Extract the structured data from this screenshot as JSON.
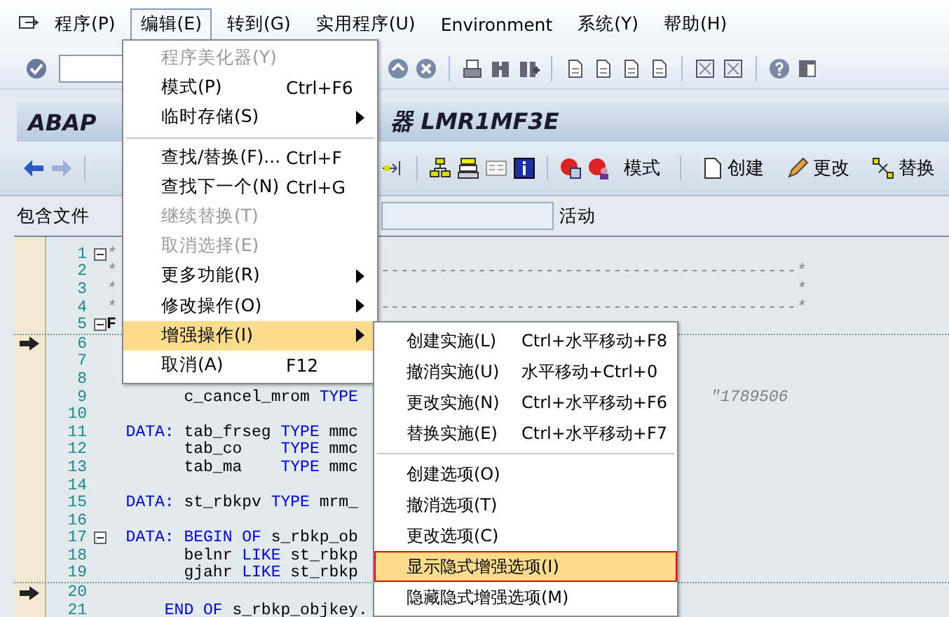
{
  "menubar": {
    "items": [
      {
        "label": "程序(P)",
        "selected": false
      },
      {
        "label": "编辑(E)",
        "selected": true
      },
      {
        "label": "转到(G)",
        "selected": false
      },
      {
        "label": "实用程序(U)",
        "selected": false
      },
      {
        "label": "Environment",
        "selected": false
      },
      {
        "label": "系统(Y)",
        "selected": false
      },
      {
        "label": "帮助(H)",
        "selected": false
      }
    ]
  },
  "title": {
    "visible_start": "ABAP",
    "visible_end": "器 LMR1MF3E"
  },
  "app_toolbar": {
    "buttons": [
      {
        "label": "模式",
        "kind": "text"
      },
      {
        "label": "创建",
        "kind": "new"
      },
      {
        "label": "更改",
        "kind": "edit"
      },
      {
        "label": "替换",
        "kind": "replace"
      }
    ]
  },
  "include_row": {
    "label": "包含文件",
    "status": "活动"
  },
  "editor": {
    "lines": [
      {
        "number": "1",
        "arrow": false,
        "collapsible": true,
        "left": [
          {
            "text": "*",
            "kind": "comment"
          }
        ]
      },
      {
        "number": "2",
        "arrow": false,
        "collapsible": false,
        "left": [
          {
            "text": "*",
            "kind": "comment"
          }
        ],
        "middle": [
          {
            "text": "-------------------------------------------*",
            "kind": "comment"
          }
        ]
      },
      {
        "number": "3",
        "arrow": false,
        "collapsible": false,
        "left": [
          {
            "text": "*",
            "kind": "comment"
          }
        ],
        "middle": [
          {
            "text": "*",
            "kind": "comment"
          }
        ]
      },
      {
        "number": "4",
        "arrow": false,
        "collapsible": false,
        "left": [
          {
            "text": "*",
            "kind": "comment"
          }
        ],
        "middle": [
          {
            "text": "-------------------------------------------*",
            "kind": "comment"
          }
        ]
      },
      {
        "number": "5",
        "arrow": false,
        "collapsible": true,
        "left": [
          {
            "text": "F",
            "kind": "bold"
          }
        ]
      },
      {
        "number": "6",
        "arrow": true,
        "collapsible": false,
        "separator": true
      },
      {
        "number": "7",
        "arrow": false,
        "collapsible": false
      },
      {
        "number": "8",
        "arrow": false,
        "collapsible": false
      },
      {
        "number": "9",
        "arrow": false,
        "collapsible": false,
        "left": [
          {
            "text": "        c_cancel_mrom ",
            "kind": "plain"
          },
          {
            "text": "TYPE",
            "kind": "keyword"
          }
        ],
        "right": [
          {
            "text": "\"1789506",
            "kind": "comment"
          }
        ]
      },
      {
        "number": "10",
        "arrow": false,
        "collapsible": false
      },
      {
        "number": "11",
        "arrow": false,
        "collapsible": false,
        "left": [
          {
            "text": "  DATA:",
            "kind": "keyword"
          },
          {
            "text": " tab_frseg ",
            "kind": "plain"
          },
          {
            "text": "TYPE",
            "kind": "keyword"
          },
          {
            "text": " mmc",
            "kind": "plain"
          }
        ]
      },
      {
        "number": "12",
        "arrow": false,
        "collapsible": false,
        "left": [
          {
            "text": "        tab_co    ",
            "kind": "plain"
          },
          {
            "text": "TYPE",
            "kind": "keyword"
          },
          {
            "text": " mmc",
            "kind": "plain"
          }
        ]
      },
      {
        "number": "13",
        "arrow": false,
        "collapsible": false,
        "left": [
          {
            "text": "        tab_ma    ",
            "kind": "plain"
          },
          {
            "text": "TYPE",
            "kind": "keyword"
          },
          {
            "text": " mmc",
            "kind": "plain"
          }
        ]
      },
      {
        "number": "14",
        "arrow": false,
        "collapsible": false
      },
      {
        "number": "15",
        "arrow": false,
        "collapsible": false,
        "left": [
          {
            "text": "  DATA:",
            "kind": "keyword"
          },
          {
            "text": " st_rbkpv ",
            "kind": "plain"
          },
          {
            "text": "TYPE",
            "kind": "keyword"
          },
          {
            "text": " mrm_",
            "kind": "plain"
          }
        ]
      },
      {
        "number": "16",
        "arrow": false,
        "collapsible": false
      },
      {
        "number": "17",
        "arrow": false,
        "collapsible": true,
        "left": [
          {
            "text": "  DATA:",
            "kind": "keyword"
          },
          {
            "text": " BEGIN OF",
            "kind": "keyword"
          },
          {
            "text": " s_rbkp_ob",
            "kind": "plain"
          }
        ]
      },
      {
        "number": "18",
        "arrow": false,
        "collapsible": false,
        "left": [
          {
            "text": "        belnr ",
            "kind": "plain"
          },
          {
            "text": "LIKE",
            "kind": "keyword"
          },
          {
            "text": " st_rbkp",
            "kind": "plain"
          }
        ]
      },
      {
        "number": "19",
        "arrow": false,
        "collapsible": false,
        "left": [
          {
            "text": "        gjahr ",
            "kind": "plain"
          },
          {
            "text": "LIKE",
            "kind": "keyword"
          },
          {
            "text": " st_rbkp",
            "kind": "plain"
          }
        ]
      },
      {
        "number": "20",
        "arrow": true,
        "collapsible": false,
        "separator": true
      },
      {
        "number": "21",
        "arrow": false,
        "collapsible": false,
        "left": [
          {
            "text": "      END OF",
            "kind": "keyword"
          },
          {
            "text": " s_rbkp_objkey.",
            "kind": "plain"
          }
        ]
      }
    ]
  },
  "edit_menu": {
    "items": [
      {
        "kind": "item",
        "label": "程序美化器(Y)",
        "disabled": true,
        "submenu": false,
        "selected": false
      },
      {
        "kind": "item",
        "label": "模式(P)",
        "shortcut": "Ctrl+F6",
        "disabled": false,
        "submenu": false,
        "selected": false
      },
      {
        "kind": "item",
        "label": "临时存储(S)",
        "disabled": false,
        "submenu": true,
        "selected": false
      },
      {
        "kind": "separator"
      },
      {
        "kind": "item",
        "label": "查找/替换(F)...",
        "shortcut": "Ctrl+F",
        "disabled": false,
        "submenu": false,
        "selected": false
      },
      {
        "kind": "item",
        "label": "查找下一个(N)",
        "shortcut": "Ctrl+G",
        "disabled": false,
        "submenu": false,
        "selected": false
      },
      {
        "kind": "item",
        "label": "继续替换(T)",
        "disabled": true,
        "submenu": false,
        "selected": false
      },
      {
        "kind": "item",
        "label": "取消选择(E)",
        "disabled": true,
        "submenu": false,
        "selected": false
      },
      {
        "kind": "item",
        "label": "更多功能(R)",
        "disabled": false,
        "submenu": true,
        "selected": false
      },
      {
        "kind": "item",
        "label": "修改操作(O)",
        "disabled": false,
        "submenu": true,
        "selected": false
      },
      {
        "kind": "item",
        "label": "增强操作(I)",
        "disabled": false,
        "submenu": true,
        "selected": true
      },
      {
        "kind": "item",
        "label": "取消(A)",
        "shortcut": "F12",
        "disabled": false,
        "submenu": false,
        "selected": false
      }
    ]
  },
  "enhancement_submenu": {
    "items": [
      {
        "kind": "item",
        "label": "创建实施(L)",
        "shortcut": "Ctrl+水平移动+F8",
        "selected": false
      },
      {
        "kind": "item",
        "label": "撤消实施(U)",
        "shortcut": "水平移动+Ctrl+0",
        "selected": false
      },
      {
        "kind": "item",
        "label": "更改实施(N)",
        "shortcut": "Ctrl+水平移动+F6",
        "selected": false
      },
      {
        "kind": "item",
        "label": "替换实施(E)",
        "shortcut": "Ctrl+水平移动+F7",
        "selected": false
      },
      {
        "kind": "separator"
      },
      {
        "kind": "item",
        "label": "创建选项(O)",
        "selected": false
      },
      {
        "kind": "item",
        "label": "撤消选项(T)",
        "selected": false
      },
      {
        "kind": "item",
        "label": "更改选项(C)",
        "selected": false
      },
      {
        "kind": "item",
        "label": "显示隐式增强选项(I)",
        "selected": true
      },
      {
        "kind": "item",
        "label": "隐藏隐式增强选项(M)",
        "selected": false
      }
    ]
  }
}
